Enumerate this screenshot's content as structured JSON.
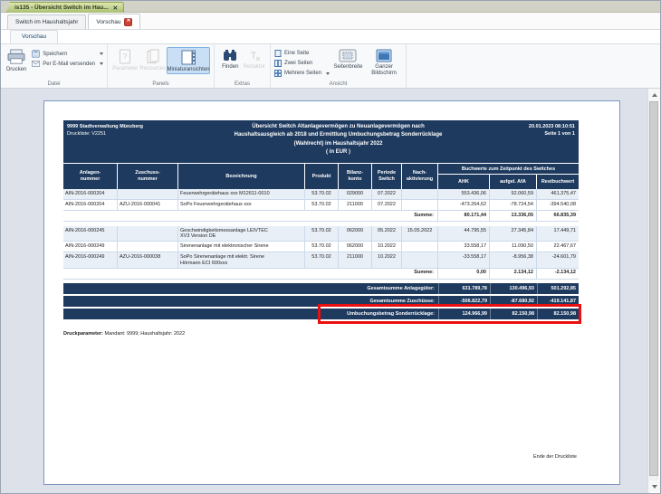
{
  "window": {
    "tab_title": "is135 - Übersicht Switch im Hau...",
    "close_glyph": "✕"
  },
  "doc_tabs": [
    {
      "label": "Switch im Haushaltsjahr"
    },
    {
      "label": "Vorschau"
    }
  ],
  "ribbon": {
    "tab": "Vorschau",
    "groups": {
      "datei": "Datei",
      "panels": "Panels",
      "extras": "Extras",
      "ansicht": "Ansicht"
    },
    "buttons": {
      "drucken": "Drucken",
      "speichern": "Speichern",
      "email": "Per E-Mail versenden",
      "parameter": "Parameter",
      "resources": "Resources",
      "miniaturansichten": "Miniaturansichten",
      "finden": "Finden",
      "redaktor": "Redaktor",
      "eine_seite": "Eine Seite",
      "zwei_seiten": "Zwei Seiten",
      "mehrere_seiten": "Mehrere Seiten",
      "seitenbreite": "Seitenbreite",
      "ganzer_bildschirm": "Ganzer\nBildschirm"
    }
  },
  "report": {
    "header": {
      "org_line1": "9999 Stadtverwaltung Münzberg",
      "org_line2": "Druckliste: V2251",
      "title_line1": "Übersicht Switch Altanlagevermögen zu Neuanlagevermögen nach",
      "title_line2": "Haushaltsausgleich ab 2018 und Ermittlung Umbuchungsbetrag Sonderrücklage",
      "title_line3": "(Wahlrecht) im Haushaltsjahr 2022",
      "title_line4": "( in EUR )",
      "datetime": "20.01.2023 08:10:51",
      "page_info": "Seite 1 von 1"
    },
    "table": {
      "columns": [
        "Anlagen-\nnummer",
        "Zuschuss-\nnummer",
        "Bezeichnung",
        "Produkt",
        "Bilanz-\nkonto",
        "Periode\nSwitch",
        "Nach-\naktivierung"
      ],
      "group_header": "Buchwerte zum Zeitpunkt des Switches",
      "value_columns": [
        "AHK",
        "aufgel. AfA",
        "Restbuchwert"
      ],
      "sum_label": "Summe:",
      "rows": [
        {
          "type": "data",
          "anlage": "AIN-2016-000204",
          "zuschuss": "",
          "bezeichnung": "Feuerwehrgerätehaus xxx M12611-0010",
          "produkt": "53.70.02",
          "bilanzkonto": "029000",
          "periode": "07.2022",
          "nachaktivierung": "",
          "ahk": "553.436,06",
          "aufgel_afa": "92.060,59",
          "restbuchwert": "461.375,47"
        },
        {
          "type": "data",
          "anlage": "AIN-2016-000204",
          "zuschuss": "AZU-2016-000041",
          "bezeichnung": "SoPo Feuerwehrgerätehaus xxx",
          "produkt": "53.70.02",
          "bilanzkonto": "211000",
          "periode": "07.2022",
          "nachaktivierung": "",
          "ahk": "-473.264,62",
          "aufgel_afa": "-78.724,54",
          "restbuchwert": "-394.540,08"
        },
        {
          "type": "sum",
          "ahk": "80.171,44",
          "aufgel_afa": "13.336,05",
          "restbuchwert": "66.835,39"
        },
        {
          "type": "data",
          "anlage": "AIN-2016-000245",
          "zuschuss": "",
          "bezeichnung": "Geschwindigkeitsmessanlage  LEIVTEC\nXV3 Version DE",
          "produkt": "53.70.02",
          "bilanzkonto": "062000",
          "periode": "05.2022",
          "nachaktivierung": "15.05.2022",
          "ahk": "44.795,55",
          "aufgel_afa": "27.345,84",
          "restbuchwert": "17.449,71"
        },
        {
          "type": "data",
          "anlage": "AIN-2016-000249",
          "zuschuss": "",
          "bezeichnung": "Sirenenanlage mit elektronischer Sirene",
          "produkt": "53.70.02",
          "bilanzkonto": "062000",
          "periode": "10.2022",
          "nachaktivierung": "",
          "ahk": "33.558,17",
          "aufgel_afa": "11.090,50",
          "restbuchwert": "22.467,67"
        },
        {
          "type": "data",
          "anlage": "AIN-2016-000249",
          "zuschuss": "AZU-2016-000038",
          "bezeichnung": "SoPo Sirenenanlage mit elektr. Sirene\nHörmann ECI 600xxx",
          "produkt": "53.70.02",
          "bilanzkonto": "211000",
          "periode": "10.2022",
          "nachaktivierung": "",
          "ahk": "-33.558,17",
          "aufgel_afa": "-8.956,38",
          "restbuchwert": "-24.601,79"
        },
        {
          "type": "sum",
          "ahk": "0,00",
          "aufgel_afa": "2.134,12",
          "restbuchwert": "-2.134,12"
        }
      ]
    },
    "totals": [
      {
        "label": "Gesamtsumme Anlagegüter:",
        "ahk": "631.789,78",
        "aufgel_afa": "130.496,93",
        "restbuchwert": "501.292,85",
        "highlighted": false
      },
      {
        "label": "Gesamtsumme Zuschüsse:",
        "ahk": "-506.822,79",
        "aufgel_afa": "-87.680,92",
        "restbuchwert": "-419.141,87",
        "highlighted": false
      },
      {
        "label": "Umbuchungsbetrag Sonderrücklage:",
        "ahk": "124.966,99",
        "aufgel_afa": "82.150,98",
        "restbuchwert": "82.150,98",
        "highlighted": true
      }
    ],
    "druckparameter_label": "Druckparameter:",
    "druckparameter_value": " Mandant: 9999; Haushaltsjahr: 2022",
    "footer": "Ende der Druckliste"
  }
}
